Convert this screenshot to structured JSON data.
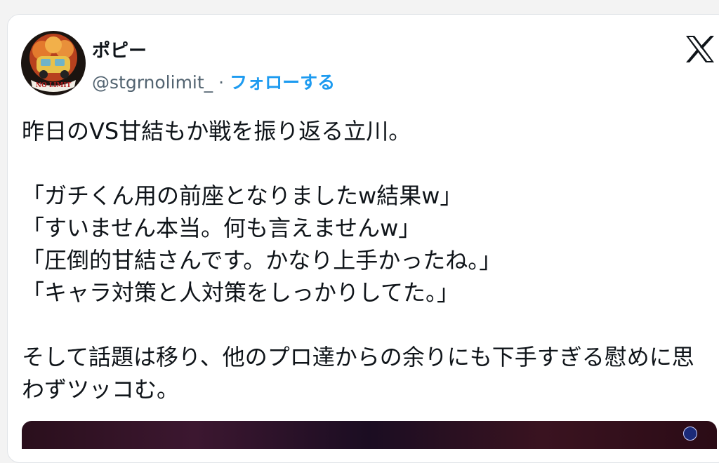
{
  "author": {
    "display_name": "ポピー",
    "handle": "@stgrnolimit_",
    "separator": "·",
    "follow_label": "フォローする",
    "avatar_text": "NO LIMIT"
  },
  "tweet": {
    "text": "昨日のVS甘結もか戦を振り返る立川。\n\n「ガチくん用の前座となりましたw結果w」\n「すいません本当。何も言えませんw」\n「圧倒的甘結さんです。かなり上手かったね。」\n「キャラ対策と人対策をしっかりしてた。」\n\nそして話題は移り、他のプロ達からの余りにも下手すぎる慰めに思わずツッコむ。"
  },
  "icons": {
    "platform_logo": "x-logo-icon",
    "media_badge": "x-badge-icon"
  },
  "colors": {
    "link": "#1d9bf0",
    "secondary_text": "#536471",
    "primary_text": "#0f1419"
  }
}
